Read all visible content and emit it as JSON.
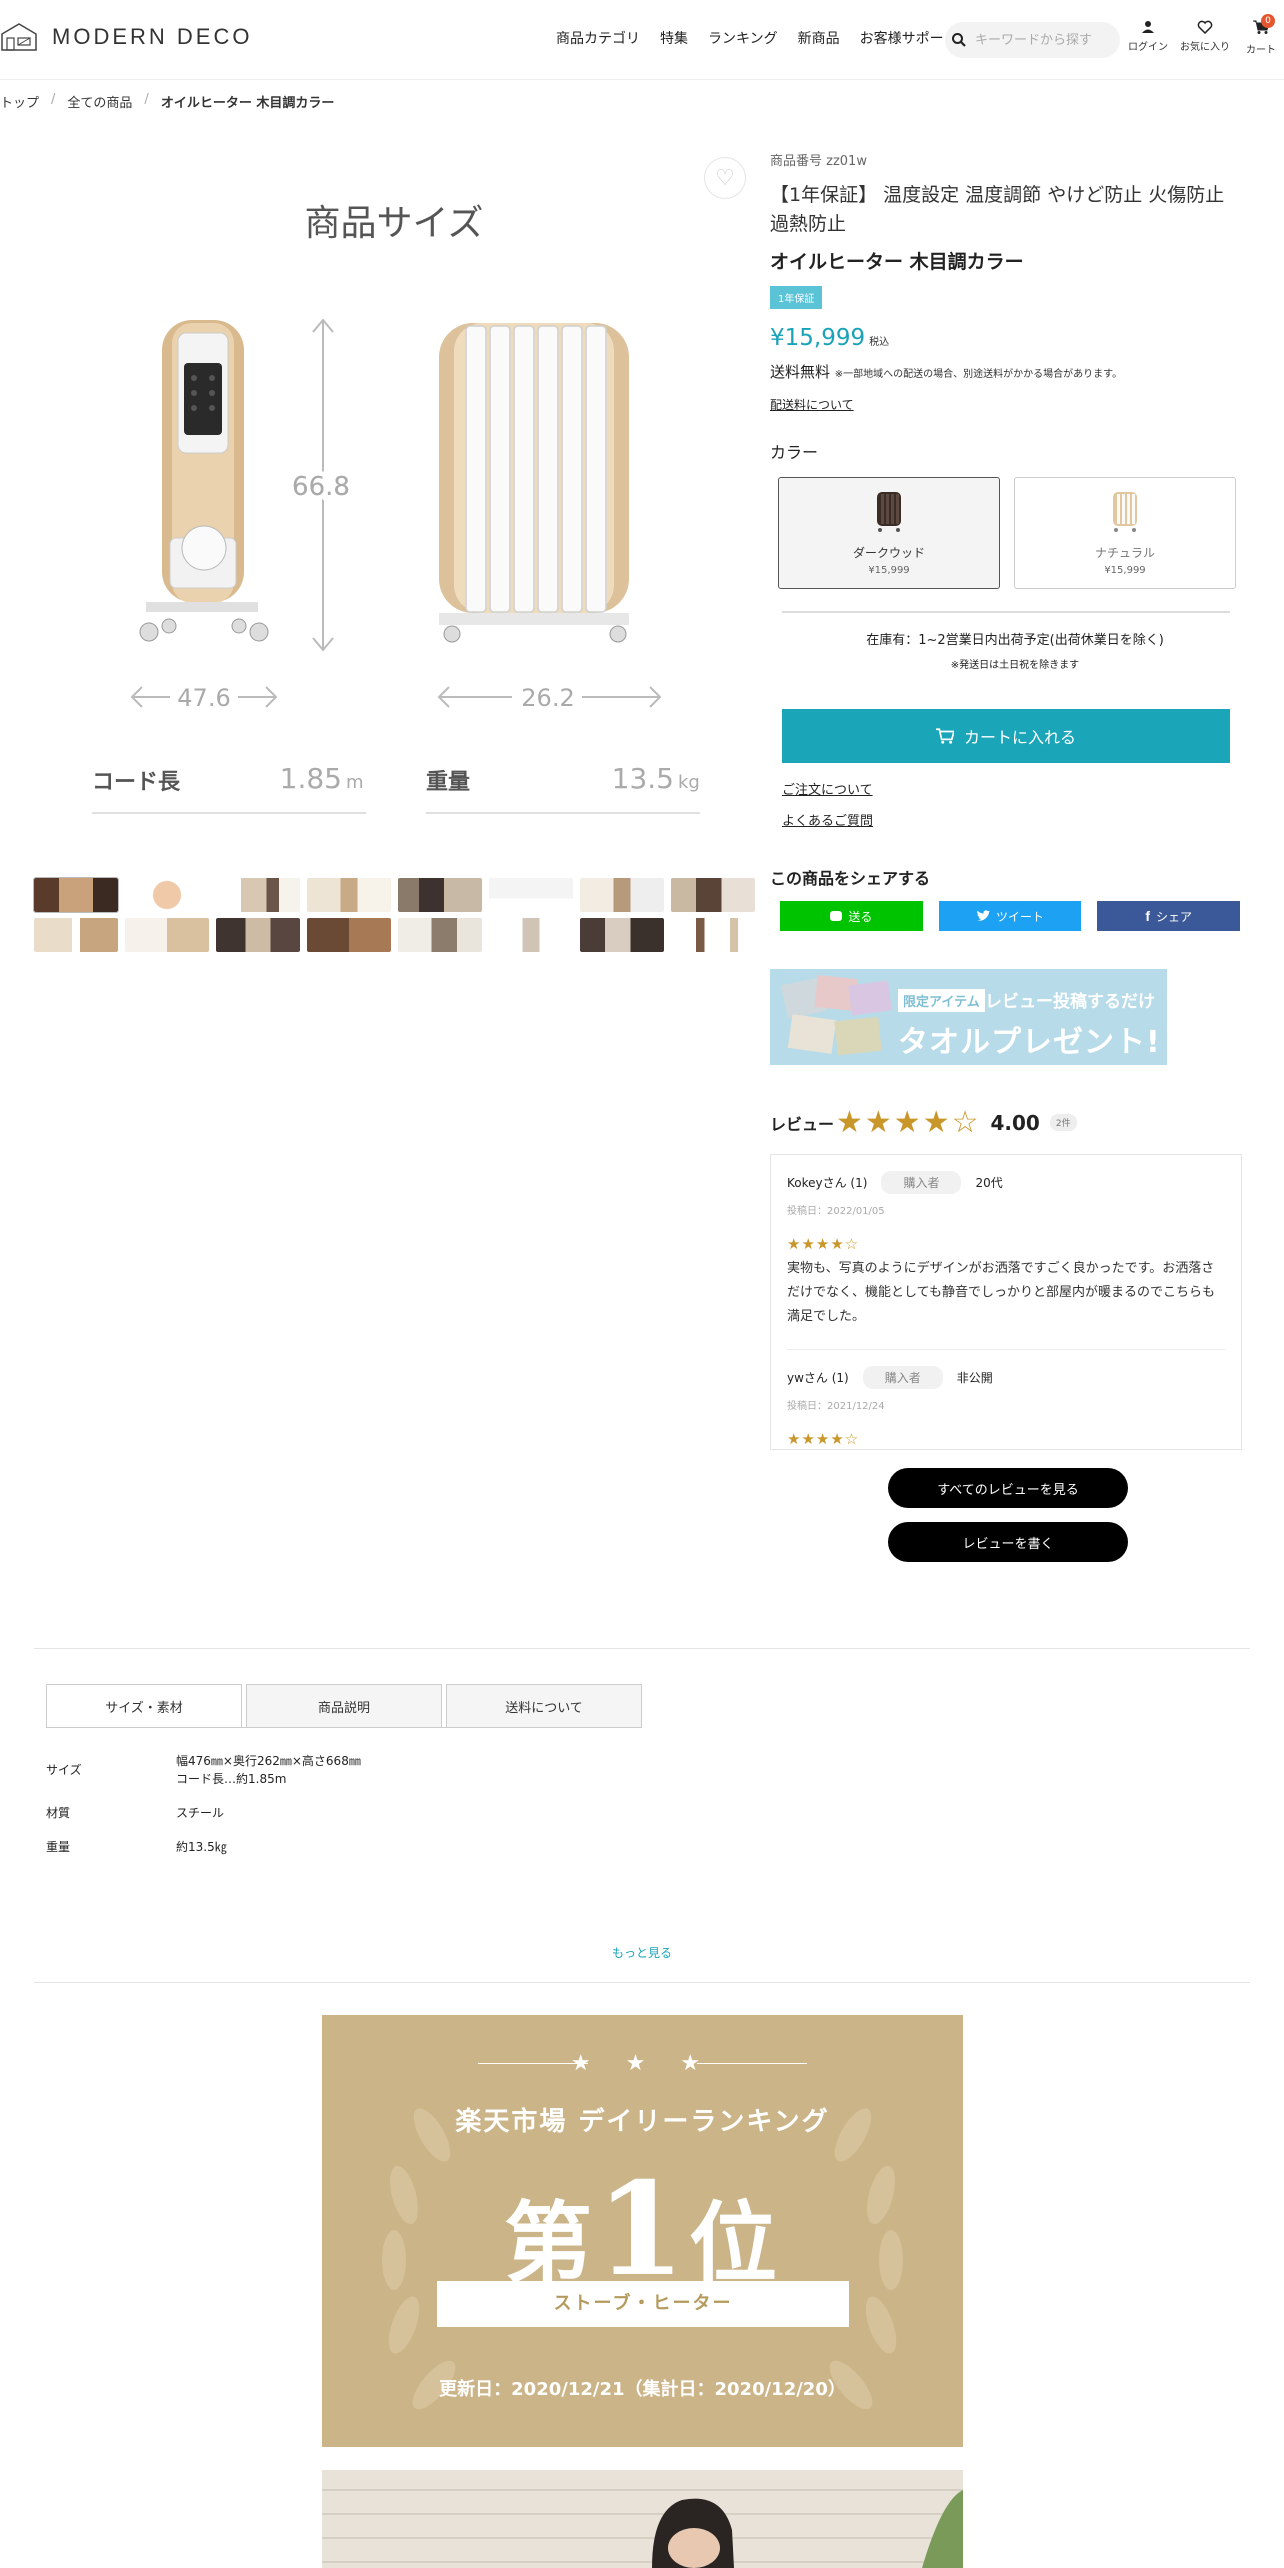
{
  "header": {
    "logo_text": "MODERN DECO",
    "nav": [
      "商品カテゴリ",
      "特集",
      "ランキング",
      "新商品",
      "お客様サポート"
    ],
    "search_placeholder": "キーワードから探す",
    "icons": [
      {
        "name": "user-icon",
        "label": "ログイン"
      },
      {
        "name": "heart-icon",
        "label": "お気に入り"
      },
      {
        "name": "cart-icon",
        "label": "カート"
      }
    ],
    "cart_count": "0"
  },
  "breadcrumb": [
    "トップ",
    "全ての商品",
    "オイルヒーター 木目調カラー"
  ],
  "main_image": {
    "title": "商品サイズ",
    "height": "66.8",
    "width": "47.6",
    "depth": "26.2",
    "cord_label": "コード長",
    "cord_value": "1.85",
    "cord_unit": "m",
    "weight_label": "重量",
    "weight_value": "13.5",
    "weight_unit": "kg"
  },
  "product": {
    "sku": "商品番号 zz01w",
    "title": "【1年保証】 温度設定 温度調節 やけど防止 火傷防止 過熱防止",
    "name": "オイルヒーター 木目調カラー",
    "warranty_badge": "1年保証",
    "price": "¥15,999",
    "tax": "税込",
    "shipping_main": "送料無料",
    "shipping_note": "※一部地域への配送の場合、別途送料がかかる場合があります。",
    "shipping_link": "配送料について",
    "color_label": "カラー",
    "colors": [
      {
        "name": "ダークウッド",
        "price": "¥15,999",
        "selected": true
      },
      {
        "name": "ナチュラル",
        "price": "¥15,999",
        "selected": false
      }
    ],
    "stock": "在庫有：1~2営業日内出荷予定(出荷休業日を除く)",
    "stock_note": "※発送日は土日祝を除きます",
    "cart_button": "カートに入れる",
    "order_link": "ご注文について",
    "faq_link": "よくあるご質問"
  },
  "share": {
    "title": "この商品をシェアする",
    "line": "送る",
    "twitter": "ツイート",
    "facebook": "シェア"
  },
  "banner": {
    "limited": "限定アイテム",
    "line1": "レビュー投稿するだけ",
    "line2": "タオルプレゼント!"
  },
  "reviews": {
    "label": "レビュー",
    "rating": 4,
    "stars": "★★★★☆",
    "score": "4.00",
    "count": "2件",
    "items": [
      {
        "user": "Kokeyさん (1)",
        "tag": "購入者",
        "age": "20代",
        "date": "投稿日：2022/01/05",
        "stars": "★★★★☆",
        "body": "実物も、写真のようにデザインがお洒落ですごく良かったです。お洒落さだけでなく、機能としても静音でしっかりと部屋内が暖まるのでこちらも満足でした。"
      },
      {
        "user": "ywさん (1)",
        "tag": "購入者",
        "age": "非公開",
        "date": "投稿日：2021/12/24",
        "stars": "★★★★☆",
        "body": ""
      }
    ],
    "all_button": "すべてのレビューを見る",
    "write_button": "レビューを書く"
  },
  "tabs": [
    "サイズ・素材",
    "商品説明",
    "送料について"
  ],
  "spec": [
    {
      "key": "サイズ",
      "value": "幅476㎜×奥行262㎜×高さ668㎜",
      "value2": "コード長…約1.85m"
    },
    {
      "key": "材質",
      "value": "スチール",
      "value2": ""
    },
    {
      "key": "重量",
      "value": "約13.5㎏",
      "value2": ""
    }
  ],
  "more_link": "もっと見る",
  "ranking": {
    "stars": "★ ★ ★",
    "line1": "楽天市場 デイリーランキング",
    "main_pre": "第",
    "main_num": "1",
    "main_post": "位",
    "category": "ストーブ・ヒーター",
    "footer": "更新日：2020/12/21（集計日：2020/12/20）"
  },
  "colors": {
    "accent": "#1ba5b9",
    "star": "#c9962a",
    "ranking_bg": "#cbb487"
  }
}
